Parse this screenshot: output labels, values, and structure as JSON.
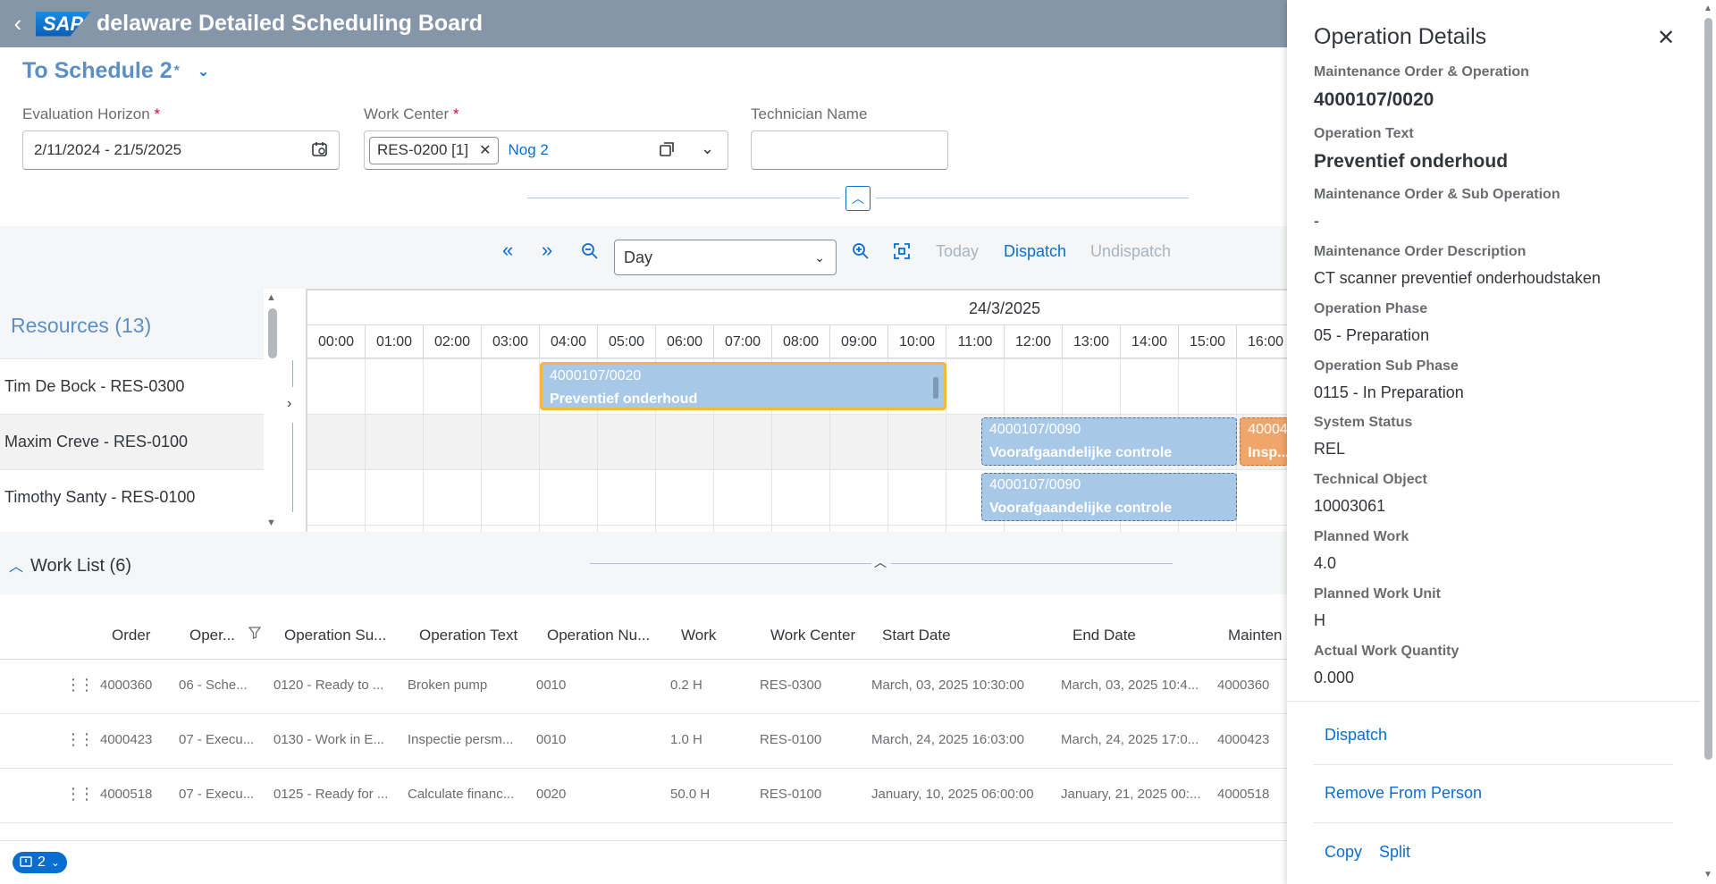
{
  "shell": {
    "title": "delaware Detailed Scheduling Board",
    "logo": "SAP"
  },
  "filter": {
    "variant_name": "To Schedule 2",
    "variant_dirty": "*",
    "horizon_label": "Evaluation Horizon",
    "horizon_value": "2/11/2024 - 21/5/2025",
    "workcenter_label": "Work Center",
    "workcenter_token": "RES-0200 [1]",
    "workcenter_more": "Nog 2",
    "technician_label": "Technician Name",
    "technician_value": "",
    "required_mark": "*"
  },
  "toolbar": {
    "view_value": "Day",
    "today_label": "Today",
    "dispatch_label": "Dispatch",
    "undispatch_label": "Undispatch"
  },
  "gantt": {
    "resources_title": "Resources (13)",
    "day_label": "24/3/2025",
    "hours": [
      "00:00",
      "01:00",
      "02:00",
      "03:00",
      "04:00",
      "05:00",
      "06:00",
      "07:00",
      "08:00",
      "09:00",
      "10:00",
      "11:00",
      "12:00",
      "13:00",
      "14:00",
      "15:00",
      "16:00"
    ],
    "resources": [
      "Tim De Bock - RES-0300",
      "Maxim Creve - RES-0100",
      "Timothy Santy - RES-0100"
    ],
    "shapes": [
      {
        "order": "4000107/0020",
        "text": "Preventief onderhoud",
        "row": 0,
        "start": 4.0,
        "end": 11.0,
        "style": "selected"
      },
      {
        "order": "4000107/0090",
        "text": "Voorafgaandelijke controle",
        "row": 1,
        "start": 11.6,
        "end": 16.0,
        "style": "blue"
      },
      {
        "order": "40004",
        "text": "Insp...",
        "row": 1,
        "start": 16.05,
        "end": 17.0,
        "style": "orange"
      },
      {
        "order": "4000107/0090",
        "text": "Voorafgaandelijke controle",
        "row": 2,
        "start": 11.6,
        "end": 16.0,
        "style": "blue"
      }
    ]
  },
  "worklist": {
    "title": "Work List (6)",
    "columns": [
      "Order",
      "Oper...",
      "Operation Su...",
      "Operation Text",
      "Operation Nu...",
      "Work",
      "Work Center",
      "Start Date",
      "End Date",
      "Mainten"
    ],
    "rows": [
      [
        "4000360",
        "06 - Sche...",
        "0120 - Ready to ...",
        "Broken pump",
        "0010",
        "0.2 H",
        "RES-0300",
        "March, 03, 2025 10:30:00",
        "March, 03, 2025 10:4...",
        "4000360"
      ],
      [
        "4000423",
        "07 - Execu...",
        "0130 - Work in E...",
        "Inspectie persm...",
        "0010",
        "1.0 H",
        "RES-0100",
        "March, 24, 2025 16:03:00",
        "March, 24, 2025 17:0...",
        "4000423"
      ],
      [
        "4000518",
        "07 - Execu...",
        "0125 - Ready for ...",
        "Calculate financ...",
        "0020",
        "50.0 H",
        "RES-0100",
        "January, 10, 2025 06:00:00",
        "January, 21, 2025 00:...",
        "4000518"
      ]
    ]
  },
  "footer": {
    "message_count": "2"
  },
  "panel": {
    "title": "Operation Details",
    "fields": [
      {
        "label": "Maintenance Order & Operation",
        "value": "4000107/0020",
        "big": true
      },
      {
        "label": "Operation Text",
        "value": "Preventief onderhoud",
        "big": true
      },
      {
        "label": "Maintenance Order & Sub Operation",
        "value": "-"
      },
      {
        "label": "Maintenance Order Description",
        "value": "CT scanner preventief onderhoudstaken"
      },
      {
        "label": "Operation Phase",
        "value": "05 - Preparation"
      },
      {
        "label": "Operation Sub Phase",
        "value": "0115 - In Preparation"
      },
      {
        "label": "System Status",
        "value": "REL"
      },
      {
        "label": "Technical Object",
        "value": "10003061"
      },
      {
        "label": "Planned Work",
        "value": "4.0"
      },
      {
        "label": "Planned Work Unit",
        "value": "H"
      },
      {
        "label": "Actual Work Quantity",
        "value": "0.000"
      }
    ],
    "actions": {
      "dispatch": "Dispatch",
      "remove": "Remove From Person",
      "copy": "Copy",
      "split": "Split"
    }
  }
}
